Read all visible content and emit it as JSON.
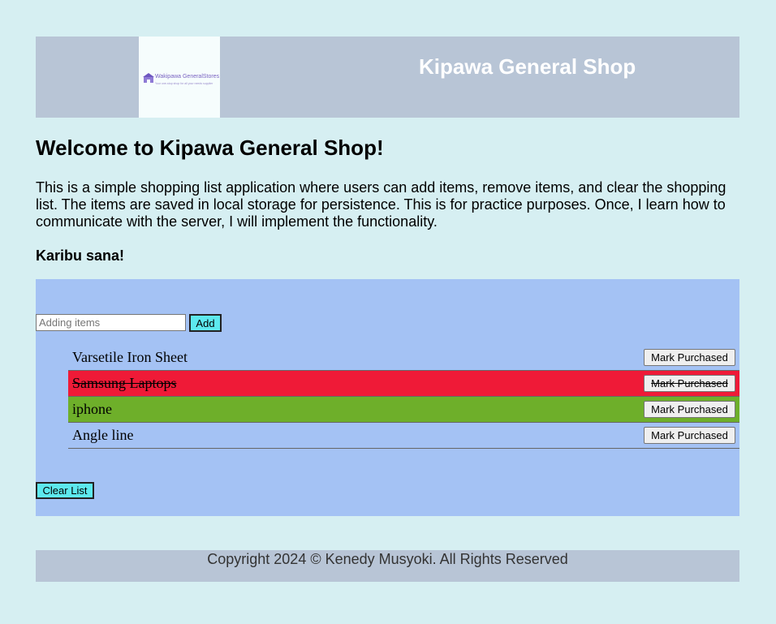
{
  "header": {
    "title": "Kipawa General Shop",
    "logo": {
      "name": "Wakipawa GeneralStores",
      "tagline": "Your one-stop shop for all your needs supplier"
    }
  },
  "main": {
    "welcome_heading": "Welcome to Kipawa General Shop!",
    "intro_text": "This is a simple shopping list application where users can add items, remove items, and clear the shopping list. The items are saved in local storage for persistence. This is for practice purposes. Once, I learn how to communicate with the server, I will implement the functionality.",
    "greeting": "Karibu sana!"
  },
  "shopping_list": {
    "input_placeholder": "Adding items",
    "input_value": "",
    "add_label": "Add",
    "clear_label": "Clear List",
    "items": [
      {
        "name": "Varsetile Iron Sheet",
        "button_label": "Mark Purchased",
        "state": "normal"
      },
      {
        "name": "Samsung Laptops",
        "button_label": "Mark Purchased",
        "state": "purchased"
      },
      {
        "name": "iphone",
        "button_label": "Mark Purchased",
        "state": "highlight"
      },
      {
        "name": "Angle line",
        "button_label": "Mark Purchased",
        "state": "normal"
      }
    ]
  },
  "footer": {
    "text": "Copyright 2024 © Kenedy Musyoki. All Rights Reserved"
  },
  "colors": {
    "page_background": "#d6eff2",
    "header_background": "#b8c5d6",
    "list_panel_background": "#a4c2f4",
    "button_accent": "#5de9ee",
    "purchased_row": "#ef1a37",
    "highlight_row": "#6eaf2a"
  }
}
